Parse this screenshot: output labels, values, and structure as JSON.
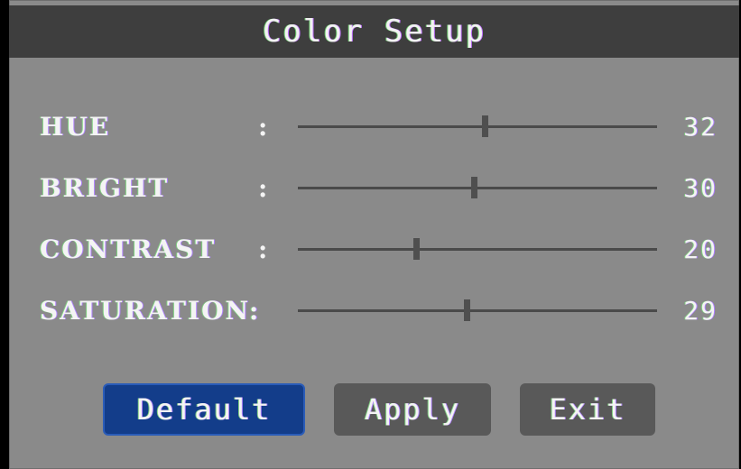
{
  "dialog": {
    "title": "Color Setup"
  },
  "settings": [
    {
      "label": "HUE",
      "colon": ":",
      "value": "32",
      "level": 0.52
    },
    {
      "label": "BRIGHT",
      "colon": ":",
      "value": "30",
      "level": 0.49
    },
    {
      "label": "CONTRAST",
      "colon": ":",
      "value": "20",
      "level": 0.33
    },
    {
      "label": "SATURATION",
      "colon": ":",
      "value": "29",
      "level": 0.47
    }
  ],
  "buttons": {
    "default_label": "Default",
    "apply_label": "Apply",
    "exit_label": "Exit"
  },
  "colors": {
    "title_bar": "#3e3e3e",
    "panel": "#8a8a8a",
    "selected_button": "#133d8a",
    "button": "#595959",
    "text": "#f4f4f4"
  }
}
